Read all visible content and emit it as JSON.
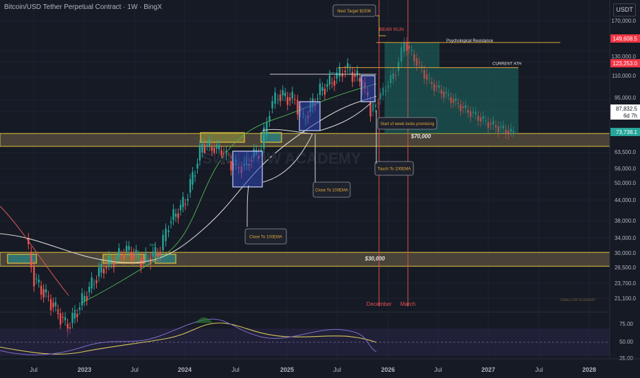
{
  "title": "Bitcoin/USD Tether Perpetual Contract · 1W · BingX",
  "currency": "USDT",
  "watermark": "SWALLOW ACADEMY",
  "watermark_small": "SWALLOW ACADEMY",
  "price_axis": {
    "ticks": [
      "170,000.0",
      "130,000.0",
      "110,000.0",
      "95,000.0",
      "63,500.0",
      "56,000.0",
      "50,000.0",
      "44,000.0",
      "38,000.0",
      "34,000.0",
      "30,000.0",
      "26,500.0",
      "23,700.0",
      "21,100.0"
    ],
    "badges": {
      "target": "149,608.5",
      "ath": "123,253.0",
      "last_price": "87,832.5",
      "last_countdown": "6d 7h",
      "support": "73,738.1"
    }
  },
  "time_axis": [
    "Jul",
    "2023",
    "Jul",
    "2024",
    "Jul",
    "2025",
    "Jul",
    "2026",
    "Jul",
    "2027",
    "Jul",
    "2028"
  ],
  "rsi_axis": [
    "75.00",
    "50.00",
    "25.00"
  ],
  "annotations": {
    "next_target": "Next Target $150K",
    "bear_run": "BEAR RUN",
    "psychological": "Psychological Resistance",
    "current_ath": "CURRENT ATH",
    "start_week": "Start of week looks promising",
    "touch_100": "Touch To 100EMA",
    "close_100_a": "Close To 100EMA",
    "close_100_b": "Close To 100EMA",
    "zone_70k": "$70,000",
    "zone_30k": "$30,000",
    "bos1": "bos",
    "bos2": "bos",
    "december": "December",
    "march": "March"
  },
  "chart_data": {
    "type": "candlestick",
    "symbol": "BTCUSDT.P",
    "timeframe": "1W",
    "y_scale": "log",
    "ylim": [
      19500,
      185000
    ],
    "last_price": 87832.5,
    "levels": {
      "psychological_resistance": 149608.5,
      "current_ath": 123253.0,
      "support_70k_zone": [
        67000,
        74000
      ],
      "support_30k_zone": [
        26500,
        29500
      ]
    },
    "price_path": [
      [
        "2022-06",
        33000
      ],
      [
        "2022-07",
        24000
      ],
      [
        "2022-09",
        20000
      ],
      [
        "2022-11",
        16500
      ],
      [
        "2023-01",
        21000
      ],
      [
        "2023-03",
        26000
      ],
      [
        "2023-06",
        30000
      ],
      [
        "2023-08",
        27500
      ],
      [
        "2023-10",
        30000
      ],
      [
        "2023-11",
        37000
      ],
      [
        "2024-01",
        44000
      ],
      [
        "2024-03",
        68000
      ],
      [
        "2024-05",
        65000
      ],
      [
        "2024-07",
        57000
      ],
      [
        "2024-08",
        58000
      ],
      [
        "2024-10",
        66000
      ],
      [
        "2024-11",
        90000
      ],
      [
        "2024-12",
        100000
      ],
      [
        "2025-02",
        96000
      ],
      [
        "2025-03",
        82000
      ],
      [
        "2025-05",
        103000
      ],
      [
        "2025-07",
        115000
      ],
      [
        "2025-08",
        123000
      ],
      [
        "2025-10",
        110000
      ],
      [
        "2025-11",
        87800
      ]
    ],
    "projection": [
      [
        "2025-11",
        87800
      ],
      [
        "2026-02",
        120000
      ],
      [
        "2026-03",
        150000
      ],
      [
        "2026-06",
        110000
      ],
      [
        "2026-10",
        90000
      ],
      [
        "2027-01",
        80000
      ],
      [
        "2027-04",
        74000
      ]
    ],
    "rsi_range": [
      25,
      75
    ]
  }
}
